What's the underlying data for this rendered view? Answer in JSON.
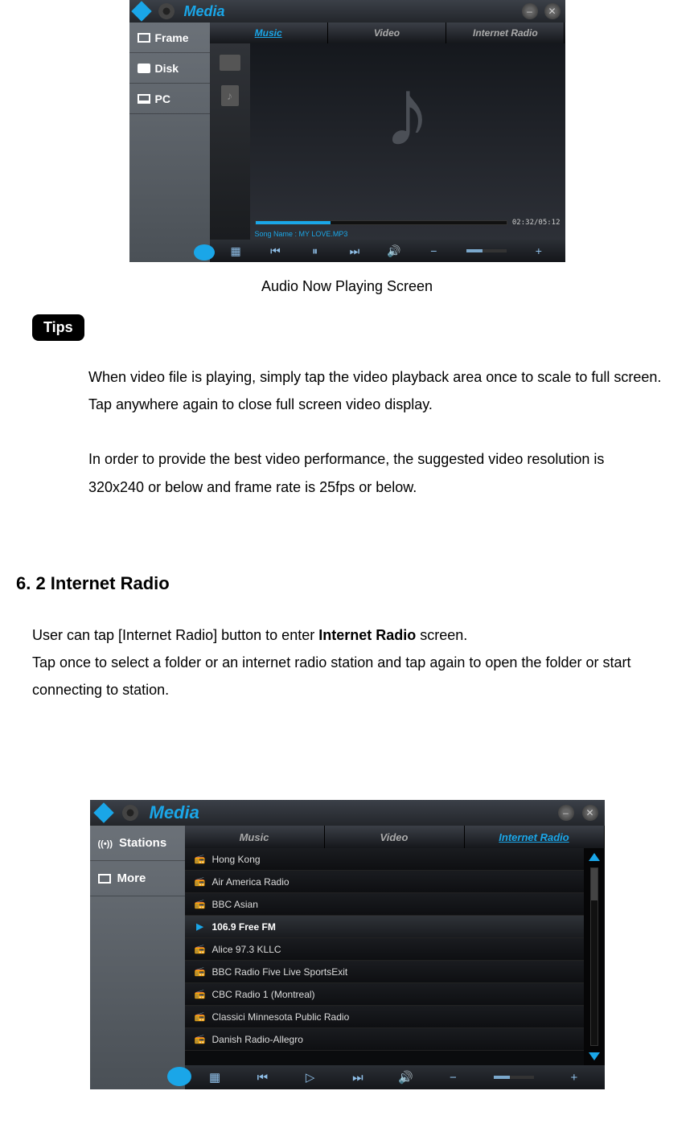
{
  "screenshot1": {
    "title": "Media",
    "sidebar": {
      "items": [
        "Frame",
        "Disk",
        "PC"
      ]
    },
    "tabs": {
      "music": "Music",
      "video": "Video",
      "radio": "Internet Radio"
    },
    "time": "02:32/05:12",
    "song_name": "Song Name : MY LOVE.MP3"
  },
  "caption1": "Audio Now Playing Screen",
  "tips_label": "Tips",
  "tip_1": "When video file is playing, simply tap the video playback area once to scale to full screen.    Tap anywhere again to close full screen video display.",
  "tip_2": "In order to provide the best video performance, the suggested video resolution is 320x240 or below and frame rate is 25fps or below.",
  "section_heading": "6. 2 Internet Radio",
  "body_para_1a": "User can tap [Internet Radio] button to enter ",
  "body_para_1b": "Internet Radio",
  "body_para_1c": " screen.",
  "body_para_2": "Tap once to select a folder or an internet radio station and tap again to open the folder or start connecting to station.",
  "screenshot2": {
    "title": "Media",
    "sidebar": {
      "items": [
        "Stations",
        "More"
      ]
    },
    "tabs": {
      "music": "Music",
      "video": "Video",
      "radio": "Internet Radio"
    },
    "stations": [
      "Hong Kong",
      "Air America Radio",
      "BBC Asian",
      "106.9 Free FM",
      "Alice 97.3 KLLC",
      "BBC Radio Five Live SportsExit",
      "CBC Radio 1 (Montreal)",
      "Classici Minnesota Public Radio",
      "Danish Radio-Allegro"
    ],
    "selected_index": 3
  }
}
